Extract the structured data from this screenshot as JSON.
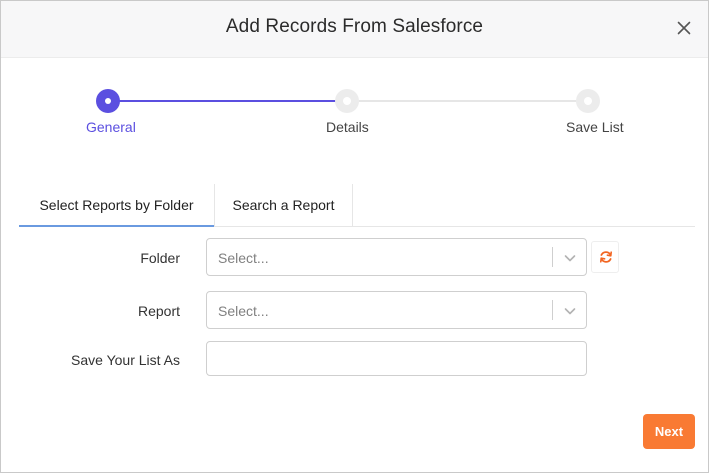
{
  "modal": {
    "title": "Add Records From Salesforce",
    "close_icon": "close-icon"
  },
  "stepper": {
    "current_step": 1,
    "steps": [
      {
        "label": "General",
        "state": "active"
      },
      {
        "label": "Details",
        "state": "pending"
      },
      {
        "label": "Save List",
        "state": "pending"
      }
    ]
  },
  "tabs": [
    {
      "label": "Select Reports by Folder",
      "active": true
    },
    {
      "label": "Search a Report",
      "active": false
    }
  ],
  "form": {
    "folder": {
      "label": "Folder",
      "placeholder": "Select...",
      "value": ""
    },
    "report": {
      "label": "Report",
      "placeholder": "Select...",
      "value": ""
    },
    "save_as": {
      "label": "Save Your List As",
      "value": ""
    },
    "refresh_icon": "refresh-icon"
  },
  "footer": {
    "next_label": "Next"
  },
  "colors": {
    "accent": "#5b4fe0",
    "cta": "#f97a33",
    "refresh": "#f26522",
    "tab_indicator": "#6a9ae0"
  }
}
